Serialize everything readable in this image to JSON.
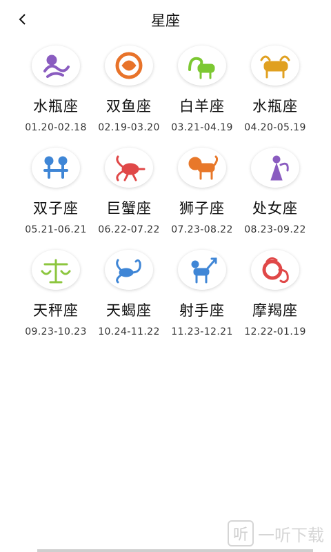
{
  "header": {
    "title": "星座",
    "back_icon": "chevron-left-icon"
  },
  "signs": [
    {
      "name": "水瓶座",
      "range": "01.20-02.18",
      "icon": "aquarius-icon",
      "color": "#8a5cc0"
    },
    {
      "name": "双鱼座",
      "range": "02.19-03.20",
      "icon": "pisces-icon",
      "color": "#e8732a"
    },
    {
      "name": "白羊座",
      "range": "03.21-04.19",
      "icon": "aries-icon",
      "color": "#7cc832"
    },
    {
      "name": "水瓶座",
      "range": "04.20-05.19",
      "icon": "taurus-icon",
      "color": "#e0a020"
    },
    {
      "name": "双子座",
      "range": "05.21-06.21",
      "icon": "gemini-icon",
      "color": "#3f86d6"
    },
    {
      "name": "巨蟹座",
      "range": "06.22-07.22",
      "icon": "cancer-icon",
      "color": "#e04848"
    },
    {
      "name": "狮子座",
      "range": "07.23-08.22",
      "icon": "leo-icon",
      "color": "#e8782a"
    },
    {
      "name": "处女座",
      "range": "08.23-09.22",
      "icon": "virgo-icon",
      "color": "#8a5cc0"
    },
    {
      "name": "天秤座",
      "range": "09.23-10.23",
      "icon": "libra-icon",
      "color": "#8cc63e"
    },
    {
      "name": "天蝎座",
      "range": "10.24-11.22",
      "icon": "scorpio-icon",
      "color": "#3f86d6"
    },
    {
      "name": "射手座",
      "range": "11.23-12.21",
      "icon": "sagittarius-icon",
      "color": "#3f86d6"
    },
    {
      "name": "摩羯座",
      "range": "12.22-01.19",
      "icon": "capricorn-icon",
      "color": "#e04848"
    }
  ],
  "watermark": {
    "glyph": "听",
    "text": "一听下载"
  }
}
